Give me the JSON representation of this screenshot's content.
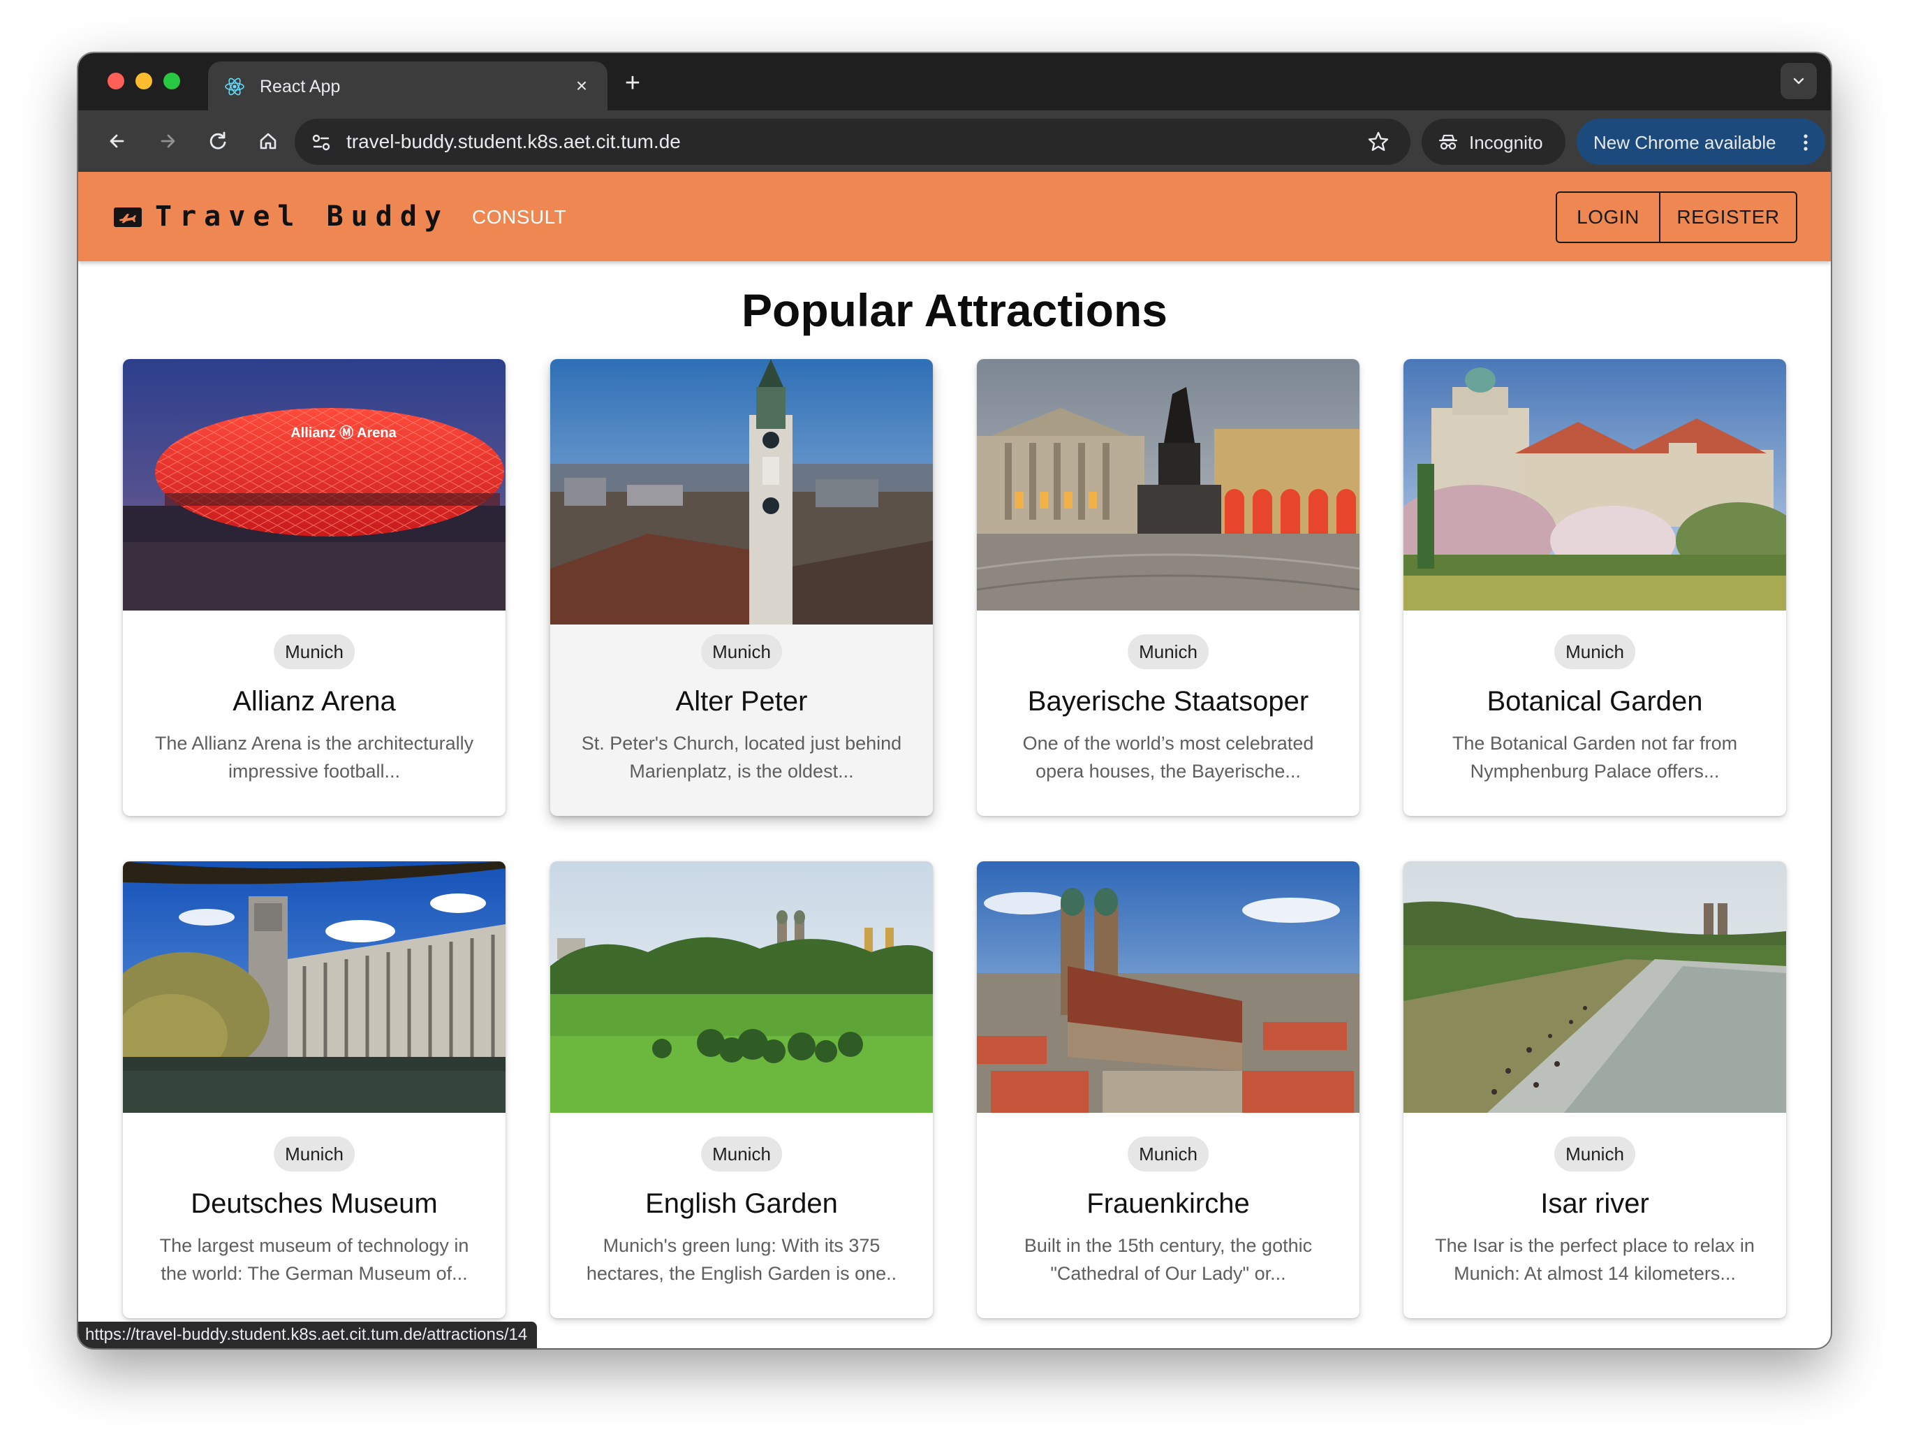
{
  "browser": {
    "tab_title": "React App",
    "url": "travel-buddy.student.k8s.aet.cit.tum.de",
    "incognito_label": "Incognito",
    "update_label": "New Chrome available",
    "status_url": "https://travel-buddy.student.k8s.aet.cit.tum.de/attractions/14"
  },
  "header": {
    "logo_text": "Travel Buddy",
    "consult_label": "CONSULT",
    "login_label": "LOGIN",
    "register_label": "REGISTER",
    "brand_color": "#ee8751"
  },
  "page": {
    "title": "Popular Attractions"
  },
  "attractions": [
    {
      "city": "Munich",
      "name": "Allianz Arena",
      "description": "The Allianz Arena is the architecturally impressive football..."
    },
    {
      "city": "Munich",
      "name": "Alter Peter",
      "description": "St. Peter's Church, located just behind Marienplatz, is the oldest..."
    },
    {
      "city": "Munich",
      "name": "Bayerische Staatsoper",
      "description": "One of the world’s most celebrated opera houses, the Bayerische..."
    },
    {
      "city": "Munich",
      "name": "Botanical Garden",
      "description": "The Botanical Garden not far from Nymphenburg Palace offers..."
    },
    {
      "city": "Munich",
      "name": "Deutsches Museum",
      "description": "The largest museum of technology in the world: The German Museum of..."
    },
    {
      "city": "Munich",
      "name": "English Garden",
      "description": "Munich's green lung: With its 375 hectares, the English Garden is one.."
    },
    {
      "city": "Munich",
      "name": "Frauenkirche",
      "description": "Built in the 15th century, the gothic \"Cathedral of Our Lady\" or..."
    },
    {
      "city": "Munich",
      "name": "Isar river",
      "description": "The Isar is the perfect place to relax in Munich: At almost 14 kilometers..."
    }
  ],
  "photo_labels": {
    "arena_sign": "Allianz Ⓜ Arena"
  }
}
